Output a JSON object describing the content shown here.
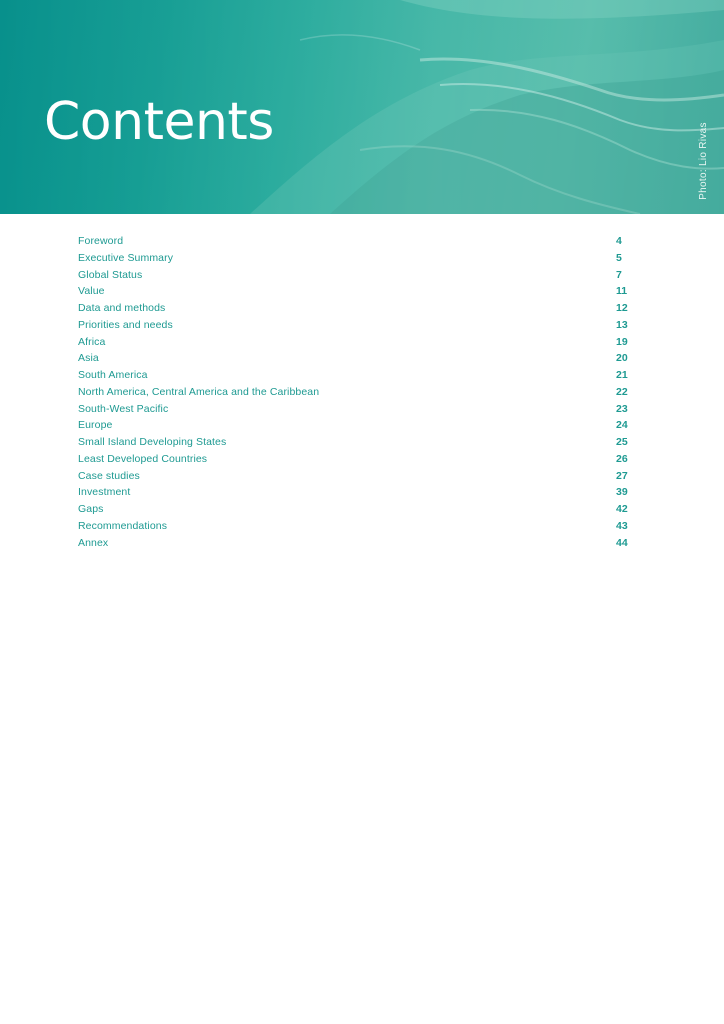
{
  "header": {
    "title": "Contents",
    "photo_credit": "Photo: Lio Rivas"
  },
  "colors": {
    "accent": "#1e9a92",
    "hero_dark": "#08908c",
    "hero_light": "#48b7a4"
  },
  "toc": [
    {
      "label": "Foreword",
      "page": "4"
    },
    {
      "label": "Executive Summary",
      "page": "5"
    },
    {
      "label": "Global Status",
      "page": "7"
    },
    {
      "label": "Value",
      "page": "11"
    },
    {
      "label": "Data and methods",
      "page": "12"
    },
    {
      "label": "Priorities and needs",
      "page": "13"
    },
    {
      "label": "Africa",
      "page": "19"
    },
    {
      "label": "Asia",
      "page": "20"
    },
    {
      "label": "South America",
      "page": "21"
    },
    {
      "label": "North America, Central America and the Caribbean",
      "page": "22"
    },
    {
      "label": "South-West Pacific",
      "page": "23"
    },
    {
      "label": "Europe",
      "page": "24"
    },
    {
      "label": "Small Island Developing States",
      "page": "25"
    },
    {
      "label": "Least Developed Countries",
      "page": "26"
    },
    {
      "label": "Case studies",
      "page": "27"
    },
    {
      "label": "Investment",
      "page": "39"
    },
    {
      "label": "Gaps",
      "page": "42"
    },
    {
      "label": "Recommendations",
      "page": "43"
    },
    {
      "label": "Annex",
      "page": "44"
    }
  ]
}
